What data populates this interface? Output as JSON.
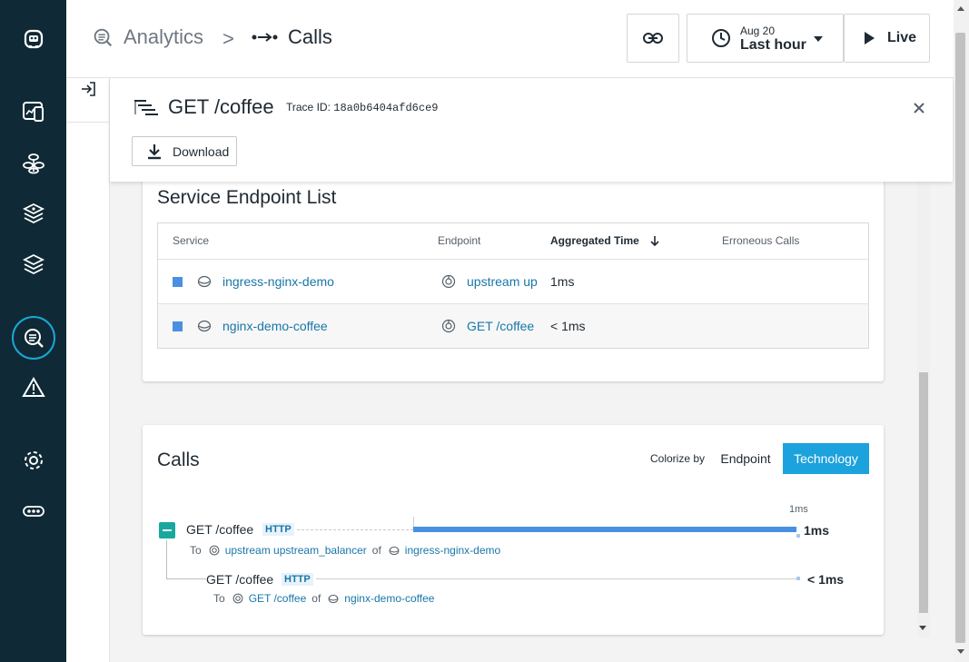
{
  "colors": {
    "nav_bg": "#0f2a36",
    "accent": "#1ca2dc",
    "link": "#1877a8",
    "bar": "#4a90e2",
    "toggle": "#19a89e"
  },
  "nav": {
    "items": [
      "instana-logo-icon",
      "websites-mobile-icon",
      "applications-icon",
      "platforms-icon",
      "infrastructure-icon",
      "analytics-icon",
      "events-icon",
      "settings-icon",
      "more-icon"
    ],
    "active": "analytics-icon"
  },
  "header": {
    "breadcrumb_parent": "Analytics",
    "breadcrumb_separator": ">",
    "breadcrumb_current": "Calls",
    "time_date": "Aug 20",
    "time_range": "Last hour",
    "live_label": "Live"
  },
  "trace": {
    "title": "GET /coffee",
    "trace_id_label": "Trace ID:",
    "trace_id": "18a0b6404afd6ce9",
    "download_label": "Download"
  },
  "endpoints_card": {
    "title": "Service Endpoint List",
    "columns": [
      "Service",
      "Endpoint",
      "Aggregated Time",
      "Erroneous Calls"
    ],
    "rows": [
      {
        "service": "ingress-nginx-demo",
        "endpoint": "upstream up",
        "time": "1ms",
        "errors": ""
      },
      {
        "service": "nginx-demo-coffee",
        "endpoint": "GET /coffee",
        "time": "< 1ms",
        "errors": ""
      }
    ]
  },
  "calls_card": {
    "title": "Calls",
    "colorize_label": "Colorize by",
    "colorize_options": [
      "Endpoint",
      "Technology"
    ],
    "colorize_selected": "Technology",
    "scale_tick": "1ms",
    "calls": [
      {
        "name": "GET /coffee",
        "badge": "HTTP",
        "duration": "1ms",
        "to_label": "To",
        "endpoint": "upstream upstream_balancer",
        "of_label": "of",
        "service": "ingress-nginx-demo",
        "fraction_of_trace": 1.0
      },
      {
        "name": "GET /coffee",
        "badge": "HTTP",
        "duration": "< 1ms",
        "to_label": "To",
        "endpoint": "GET /coffee",
        "of_label": "of",
        "service": "nginx-demo-coffee",
        "fraction_of_trace": 0.0
      }
    ]
  }
}
